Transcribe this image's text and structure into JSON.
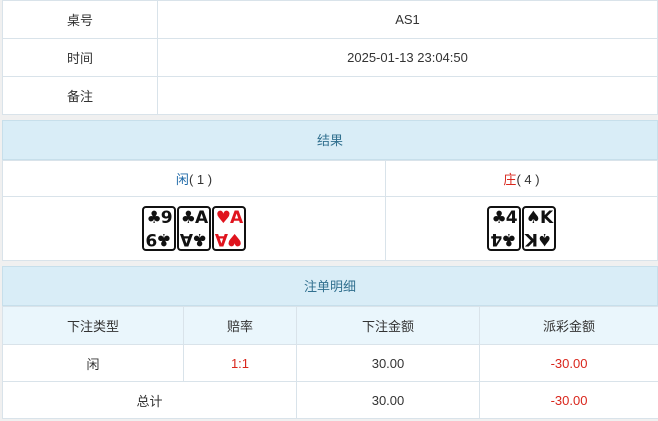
{
  "info": {
    "rows": [
      {
        "label": "桌号",
        "value": "AS1"
      },
      {
        "label": "时间",
        "value": "2025-01-13 23:04:50"
      },
      {
        "label": "备注",
        "value": ""
      }
    ]
  },
  "result": {
    "title": "结果",
    "player": {
      "label": "闲",
      "score_text": "( 1 )",
      "cards": [
        {
          "rank": "9",
          "suit": "♣",
          "color": "black",
          "icon": "clubs-icon"
        },
        {
          "rank": "A",
          "suit": "♣",
          "color": "black",
          "icon": "clubs-icon"
        },
        {
          "rank": "A",
          "suit": "♥",
          "color": "red",
          "icon": "hearts-icon"
        }
      ]
    },
    "banker": {
      "label": "庄",
      "score_text": "( 4 )",
      "cards": [
        {
          "rank": "4",
          "suit": "♣",
          "color": "black",
          "icon": "clubs-icon"
        },
        {
          "rank": "K",
          "suit": "♠",
          "color": "black",
          "icon": "spades-icon"
        }
      ]
    }
  },
  "detail": {
    "title": "注单明细",
    "headers": [
      "下注类型",
      "赔率",
      "下注金额",
      "派彩金额"
    ],
    "rows": [
      {
        "type": "闲",
        "odds": "1:1",
        "amount": "30.00",
        "payout": "-30.00"
      }
    ],
    "total": {
      "label": "总计",
      "amount": "30.00",
      "payout": "-30.00"
    }
  },
  "colors": {
    "header_bg": "#d9edf7",
    "header_text": "#31708f",
    "red": "#d9261c",
    "blue": "#1f6aa8"
  }
}
